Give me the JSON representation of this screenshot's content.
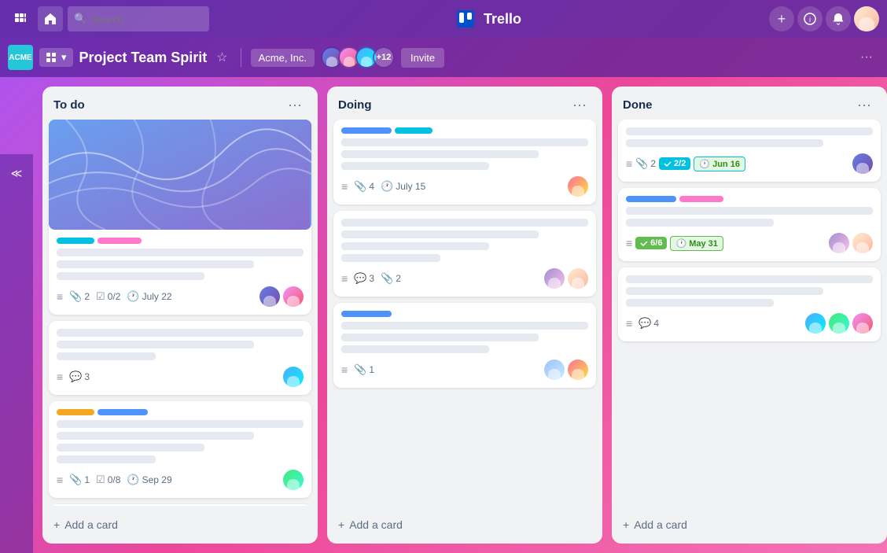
{
  "topNav": {
    "searchPlaceholder": "Search",
    "logoText": "Trello",
    "addLabel": "+",
    "infoLabel": "ⓘ",
    "bellLabel": "🔔"
  },
  "subNav": {
    "workspaceLogo": "ACME",
    "boardTitle": "Project Team Spirit",
    "viewIcon": "⊞",
    "viewChevron": "▾",
    "starLabel": "☆",
    "workspaceLabel": "Acme, Inc.",
    "avatarCount": "+12",
    "inviteLabel": "Invite",
    "moreLabel": "···"
  },
  "sidebarToggle": "≪",
  "lists": [
    {
      "id": "todo",
      "title": "To do",
      "cards": [
        {
          "id": "card-1",
          "hasCover": true,
          "labels": [
            "teal",
            "pink"
          ],
          "textLines": [
            "full",
            "medium",
            "short"
          ],
          "meta": {
            "description": true,
            "attachments": 2,
            "checklist": "0/2",
            "dueDate": "July 22"
          },
          "avatars": [
            "av1",
            "av2"
          ]
        },
        {
          "id": "card-2",
          "hasCover": false,
          "labels": [],
          "textLines": [
            "full",
            "medium",
            "xshort"
          ],
          "meta": {
            "description": true,
            "comments": 3
          },
          "avatars": [
            "av3"
          ]
        },
        {
          "id": "card-3",
          "hasCover": false,
          "labels": [
            "yellow",
            "blue"
          ],
          "textLines": [
            "full",
            "medium",
            "short",
            "xshort"
          ],
          "meta": {
            "description": true,
            "attachments": 1,
            "checklist": "0/8",
            "dueDate": "Sep 29"
          },
          "avatars": [
            "av4"
          ]
        },
        {
          "id": "card-4",
          "hasCover": false,
          "labels": [
            "teal"
          ],
          "textLines": [
            "full",
            "medium"
          ],
          "meta": {},
          "avatars": []
        }
      ],
      "addCardLabel": "Add a card"
    },
    {
      "id": "doing",
      "title": "Doing",
      "cards": [
        {
          "id": "card-5",
          "hasCover": false,
          "labels": [
            "blue",
            "teal"
          ],
          "textLines": [
            "full",
            "medium",
            "short"
          ],
          "meta": {
            "description": true,
            "attachments": 4,
            "dueDate": "July 15"
          },
          "avatars": [
            "av5"
          ]
        },
        {
          "id": "card-6",
          "hasCover": false,
          "labels": [],
          "textLines": [
            "full",
            "medium",
            "short",
            "xshort"
          ],
          "meta": {
            "description": true,
            "comments": 3,
            "attachments": 2
          },
          "avatars": [
            "av6",
            "av7"
          ]
        },
        {
          "id": "card-7",
          "hasCover": false,
          "labels": [
            "blue"
          ],
          "textLines": [
            "full",
            "medium",
            "short"
          ],
          "meta": {
            "description": true,
            "attachments": 1
          },
          "avatars": [
            "av8",
            "av5"
          ]
        }
      ],
      "addCardLabel": "Add a card"
    },
    {
      "id": "done",
      "title": "Done",
      "cards": [
        {
          "id": "card-8",
          "hasCover": false,
          "labels": [],
          "textLines": [
            "full",
            "medium"
          ],
          "meta": {
            "description": true,
            "attachments": 2,
            "checklist": "2/2",
            "dueDate": "Jun 16",
            "checkBadge": true,
            "dateBadge": true
          },
          "avatars": [
            "av1"
          ]
        },
        {
          "id": "card-9",
          "hasCover": false,
          "labels": [
            "blue",
            "pink"
          ],
          "textLines": [
            "full",
            "short"
          ],
          "meta": {
            "description": true,
            "checklist": "6/6",
            "dueDate": "May 31",
            "checkBadgeGreen": true,
            "dateBadgeGreen": true
          },
          "avatars": [
            "av6",
            "av7"
          ]
        },
        {
          "id": "card-10",
          "hasCover": false,
          "labels": [],
          "textLines": [
            "full",
            "medium",
            "short"
          ],
          "meta": {
            "description": true,
            "comments": 4
          },
          "avatars": [
            "av3",
            "av4",
            "av2"
          ]
        }
      ],
      "addCardLabel": "Add a card"
    }
  ]
}
